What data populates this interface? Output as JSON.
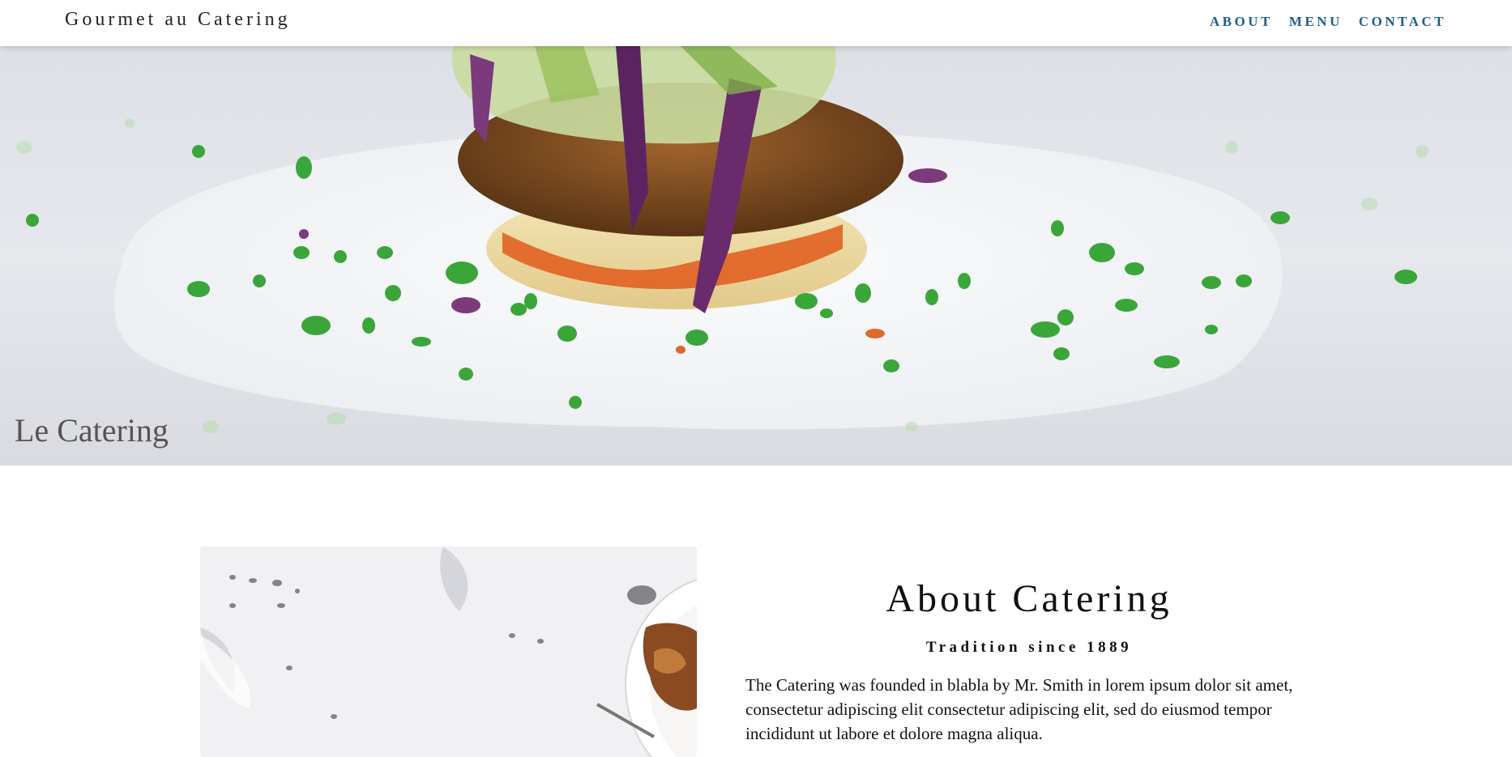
{
  "header": {
    "brand": "Gourmet au Catering",
    "nav": [
      {
        "label": "ABOUT"
      },
      {
        "label": "MENU"
      },
      {
        "label": "CONTACT"
      }
    ]
  },
  "hero": {
    "title": "Le Catering"
  },
  "about": {
    "title": "About Catering",
    "subtitle": "Tradition since 1889",
    "body": "The Catering was founded in blabla by Mr. Smith in lorem ipsum dolor sit amet, consectetur adipiscing elit consectetur adipiscing elit, sed do eiusmod tempor incididunt ut labore et dolore magna aliqua."
  },
  "colors": {
    "nav_link": "#1e5f88",
    "text": "#111111"
  }
}
